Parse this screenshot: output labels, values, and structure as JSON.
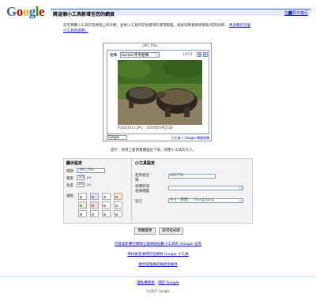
{
  "logo": {
    "letters": [
      "G",
      "o",
      "o",
      "g",
      "l",
      "e"
    ]
  },
  "header": {
    "title": "將這個小工具新增至您的網頁",
    "help_link": "在網頁中進行"
  },
  "intro": {
    "text": "您可預覽小工具在您網頁上的外觀，並視小工具的其他選項的運用範圍，請查詢看看網頁版和/或其他來。",
    "link": "更多關於這個小工具的說明」"
  },
  "preview": {
    "title": "_MG_fille...",
    "tag_label": "相簿",
    "tag_value": "Sorted 所有相簿",
    "page_count": "10/51",
    "prev": "◀",
    "next": "▶",
    "caption": "P1020411.JPG - 2009年9月25日",
    "badge": "Google",
    "links": "小工具 • Google 網路相簿"
  },
  "hint": "提示：拖曳上面預覽畫面右下角，調整小工具的大小。",
  "display_settings": {
    "heading": "顯示設定",
    "title_label": "標題",
    "title_value": "_MG_fille...",
    "width_label": "寬度",
    "width_value": "320",
    "width_unit": "px",
    "height_label": "高度",
    "height_value": "281",
    "height_unit": "px",
    "border_label": "邊框"
  },
  "gadget_settings": {
    "heading": "小工具設定",
    "user_label": "使用者名稱",
    "user_value": "600778",
    "album_label": "相簿影或\n相簿標籤",
    "album_value": "",
    "lang_label": "語言",
    "lang_value": "中文（繁體） - Hong Kong"
  },
  "buttons": {
    "preview": "預覽變更",
    "get_code": "取得程式碼"
  },
  "links": {
    "link1": "可能會影響已關閉立會網站個數小工具的 iGoogle 首頁",
    "link2": "尋找更多適用於您網頁 Google 小工具",
    "link3": "總合管理員的條款及條件"
  },
  "footer": {
    "privacy": "隱私權政策",
    "sep": " - ",
    "about": "關於 Google",
    "copyright": "©2007 Google"
  },
  "colors": {
    "accent": "#3366cc",
    "header_bg": "#e5ecf9",
    "link": "#0000cc"
  },
  "swatch_colors": [
    "#ffffff",
    "#d9e6ff",
    "#ffffff",
    "#ffe9c2",
    "#e6f5d0",
    "#ffd9d9",
    "#ffffff",
    "#ffffff",
    "#ffffff",
    "#ffffff",
    "#ffffff",
    "#ffffff"
  ]
}
